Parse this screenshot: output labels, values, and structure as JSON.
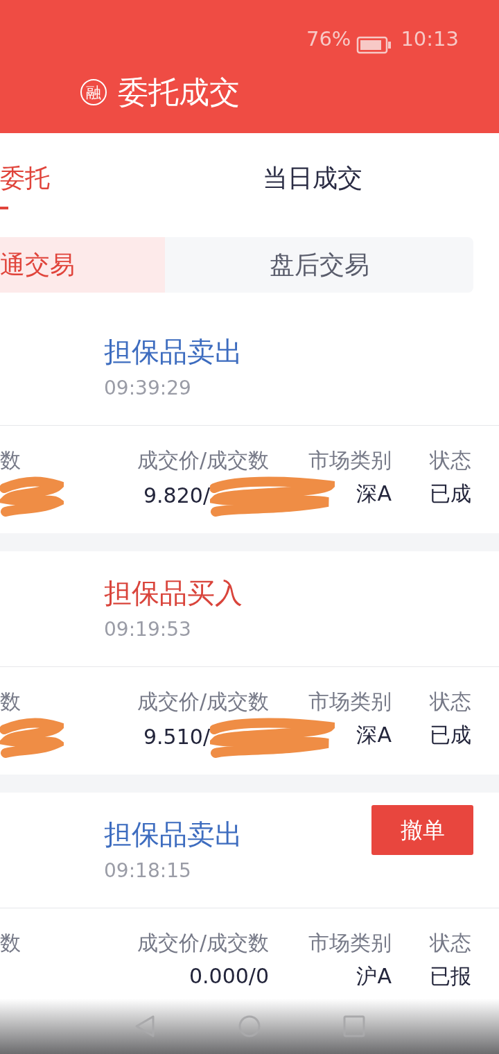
{
  "status_bar": {
    "battery_text": "76%",
    "time": "10:13"
  },
  "header": {
    "logo_char": "融",
    "title": "委托成交"
  },
  "tabs": [
    {
      "label": "委托",
      "selected": true
    },
    {
      "label": "当日成交",
      "selected": false
    }
  ],
  "segments": [
    {
      "label": "通交易",
      "selected": true
    },
    {
      "label": "盘后交易",
      "selected": false
    }
  ],
  "orders": [
    {
      "kind": "sell",
      "title": "担保品卖出",
      "time": "09:39:29",
      "fields": [
        {
          "label": "数",
          "redacted": true
        },
        {
          "label": "成交价/成交数",
          "value": "9.820/",
          "redacted": true
        },
        {
          "label": "市场类别",
          "value": "深A"
        },
        {
          "label": "状态",
          "value": "已成"
        }
      ]
    },
    {
      "kind": "buy",
      "title": "担保品买入",
      "time": "09:19:53",
      "fields": [
        {
          "label": "数",
          "redacted": true
        },
        {
          "label": "成交价/成交数",
          "value": "9.510/",
          "redacted": true
        },
        {
          "label": "市场类别",
          "value": "深A"
        },
        {
          "label": "状态",
          "value": "已成"
        }
      ]
    },
    {
      "kind": "sell",
      "title": "担保品卖出",
      "time": "09:18:15",
      "action": "撤单",
      "fields": [
        {
          "label": "数"
        },
        {
          "label": "成交价/成交数",
          "value": "0.000/0"
        },
        {
          "label": "市场类别",
          "value": "沪A"
        },
        {
          "label": "状态",
          "value": "已报"
        }
      ]
    }
  ]
}
